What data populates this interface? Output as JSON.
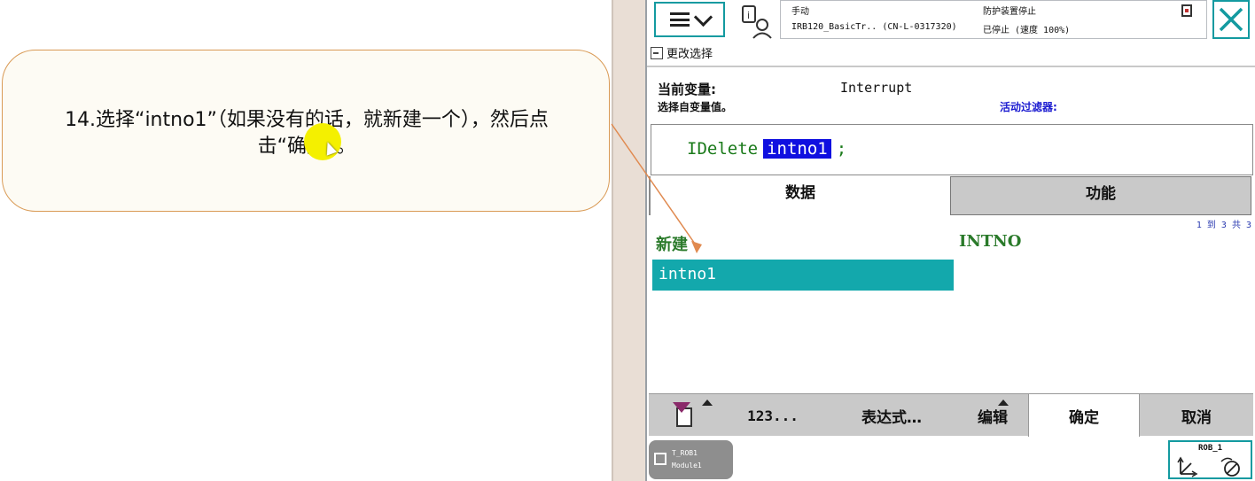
{
  "instruction": {
    "line1": "14.选择“intno1”（如果没有的话，就新建一个），然后点",
    "line2": "击“确定”。"
  },
  "flexpendant": {
    "status": {
      "mode": "手动",
      "system": "IRB120_BasicTr.. (CN-L-0317320)",
      "guard": "防护装置停止",
      "state": "已停止 (速度 100%)"
    },
    "header": "更改选择",
    "current_var_label": "当前变量:",
    "current_var_value": "Interrupt",
    "select_label": "选择自变量值。",
    "filter_label": "活动过滤器:",
    "code": {
      "instruction": "IDelete",
      "selected_arg": "intno1",
      "terminator": ";"
    },
    "tabs": [
      "数据",
      "功能"
    ],
    "count": "1 到 3 共 3",
    "list": {
      "new_item": "新建",
      "type_item": "INTNO",
      "selected_item": "intno1"
    },
    "toolbar": {
      "num": "123...",
      "expression": "表达式…",
      "edit": "编辑",
      "ok": "确定",
      "cancel": "取消"
    },
    "taskbar": {
      "task_line1": "T_ROB1",
      "task_line2": "Module1",
      "robot": "ROB_1"
    }
  },
  "colors": {
    "accent": "#139aa0",
    "selection": "#13a8ac",
    "code_highlight": "#1010e0",
    "callout_border": "#d99a55",
    "marker": "#f4f000"
  }
}
